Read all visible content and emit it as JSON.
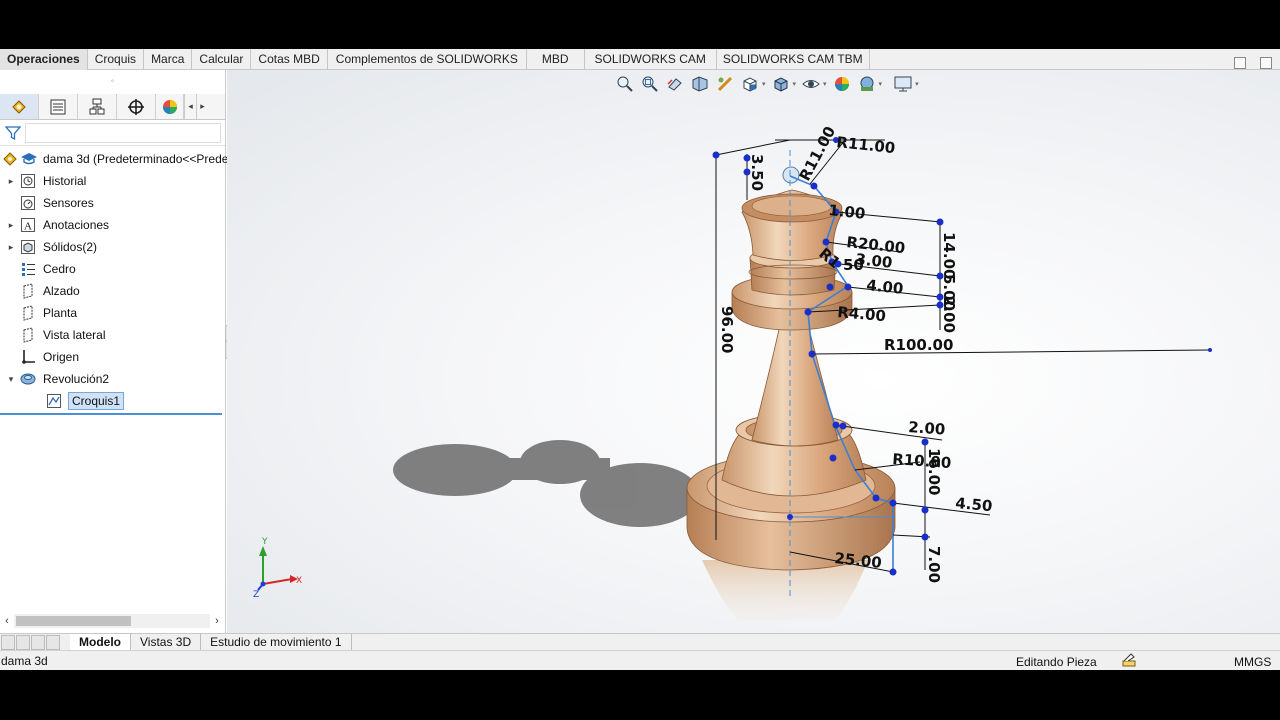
{
  "command_tabs": [
    "Operaciones",
    "Croquis",
    "Marca",
    "Calcular",
    "Cotas MBD",
    "Complementos de SOLIDWORKS",
    "MBD",
    "SOLIDWORKS CAM",
    "SOLIDWORKS CAM TBM"
  ],
  "active_command_tab": "Operaciones",
  "panel": {
    "grip": "◦",
    "tab_icons": [
      "feature-manager-icon",
      "property-manager-icon",
      "configuration-manager-icon",
      "dimxpert-manager-icon",
      "display-manager-icon"
    ],
    "tree": {
      "root": "dama 3d  (Predeterminado<<Predeterminado>",
      "items": [
        {
          "label": "Historial",
          "icon": "history-folder-icon",
          "expandable": true
        },
        {
          "label": "Sensores",
          "icon": "sensor-icon",
          "expandable": false
        },
        {
          "label": "Anotaciones",
          "icon": "annotations-icon",
          "expandable": true
        },
        {
          "label": "Sólidos(2)",
          "icon": "solid-bodies-icon",
          "expandable": true
        },
        {
          "label": "Cedro",
          "icon": "material-icon",
          "expandable": false
        },
        {
          "label": "Alzado",
          "icon": "plane-icon",
          "expandable": false
        },
        {
          "label": "Planta",
          "icon": "plane-icon",
          "expandable": false
        },
        {
          "label": "Vista lateral",
          "icon": "plane-icon",
          "expandable": false
        },
        {
          "label": "Origen",
          "icon": "origin-icon",
          "expandable": false
        },
        {
          "label": "Revolución2",
          "icon": "revolve-icon",
          "expandable": true,
          "expanded": true
        }
      ],
      "child": "Croquis1"
    }
  },
  "bottom_tabs": [
    "Modelo",
    "Vistas 3D",
    "Estudio de movimiento 1"
  ],
  "active_bottom_tab": "Modelo",
  "status": {
    "document": "dama 3d",
    "mode": "Editando Pieza",
    "units": "MMGS"
  },
  "triad": {
    "x": "X",
    "y": "Y",
    "z": "Z"
  },
  "dimensions": {
    "r11_top": "R11.00",
    "r11_diag": "R11.00",
    "d3_50": "3.50",
    "d1_00": "1.00",
    "r20": "R20.00",
    "d3_00": "3.00",
    "r1": "R1",
    "d50": "50",
    "d4_00": "4.00",
    "r4": "R4.00",
    "d14": "14.00",
    "d5": "5.00",
    "d2_00v": "2.00",
    "d96": "96.00",
    "r100": "R100.00",
    "d2_00": "2.00",
    "r10": "R10.00",
    "d16": "16.00",
    "d4_50": "4.50",
    "d25": "25.00",
    "d7": "7.00"
  }
}
